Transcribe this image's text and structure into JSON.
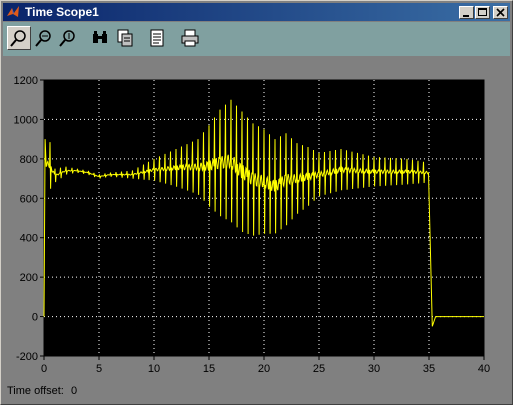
{
  "window": {
    "title": "Time Scope1",
    "controls": [
      "minimize-icon",
      "maximize-icon",
      "close-icon"
    ]
  },
  "toolbar": {
    "buttons": [
      {
        "name": "zoom-icon",
        "label": "Zoom"
      },
      {
        "name": "zoom-x-icon",
        "label": "Zoom X"
      },
      {
        "name": "zoom-y-icon",
        "label": "Zoom Y"
      },
      {
        "name": "autoscale-icon",
        "label": "Autoscale"
      },
      {
        "name": "save-axes-icon",
        "label": "Save axes settings"
      },
      {
        "name": "parameters-icon",
        "label": "Parameters"
      },
      {
        "name": "print-icon",
        "label": "Print"
      }
    ]
  },
  "footer": {
    "time_offset_label": "Time offset:",
    "time_offset_value": "0"
  },
  "colors": {
    "plot_background": "#000000",
    "trace": "#ffff00",
    "grid": "#ffffff",
    "frame_background": "#808080",
    "toolbar_background": "#80a0a0",
    "titlebar": "#0a246a"
  },
  "chart_data": {
    "type": "line",
    "title": "",
    "xlabel": "",
    "ylabel": "",
    "xlim": [
      0,
      40
    ],
    "ylim": [
      -200,
      1200
    ],
    "xticks": [
      0,
      5,
      10,
      15,
      20,
      25,
      30,
      35,
      40
    ],
    "yticks": [
      -200,
      0,
      200,
      400,
      600,
      800,
      1000,
      1200
    ],
    "grid": true,
    "grid_style": "dotted",
    "series": [
      {
        "color": "#ffff00",
        "envelope": {
          "t": [
            0,
            0.2,
            0.5,
            1.0,
            2.0,
            3.0,
            4.0,
            5.0,
            6.0,
            8.0,
            10.0,
            12.0,
            14.0,
            15.0,
            16.0,
            17.0,
            18.0,
            19.0,
            20.0,
            21.0,
            22.0,
            23.0,
            24.0,
            25.0,
            27.0,
            30.0,
            33.0,
            35.0,
            35.3
          ],
          "max": [
            0,
            900,
            900,
            750,
            760,
            750,
            740,
            720,
            730,
            740,
            800,
            850,
            900,
            970,
            1050,
            1100,
            1040,
            980,
            950,
            900,
            930,
            880,
            860,
            830,
            850,
            810,
            800,
            780,
            0
          ],
          "min": [
            0,
            650,
            640,
            680,
            720,
            730,
            720,
            700,
            710,
            700,
            690,
            660,
            620,
            560,
            510,
            480,
            430,
            410,
            420,
            420,
            460,
            520,
            560,
            610,
            640,
            660,
            670,
            680,
            -50
          ]
        },
        "tail": {
          "t": [
            35.3,
            35.6,
            40.0
          ],
          "v": [
            -50,
            0,
            0
          ]
        }
      }
    ]
  }
}
